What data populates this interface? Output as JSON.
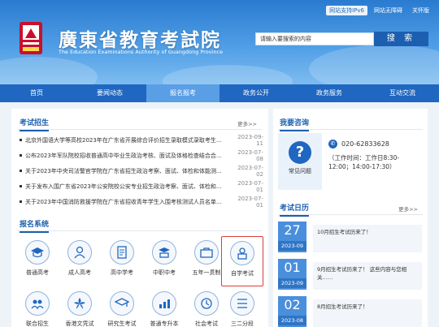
{
  "header": {
    "top_links": [
      "网站支持IPv6",
      "网站无障碍",
      "关怀版"
    ],
    "title": "廣東省教育考試院",
    "subtitle": "The Education Examinations Authority of Guangdong Province",
    "search_placeholder": "请输入要搜索的内容",
    "search_button": "搜 索"
  },
  "nav": [
    "首页",
    "要闻动态",
    "报名报考",
    "政务公开",
    "政务服务",
    "互动交流"
  ],
  "nav_active": "报名报考",
  "exam_enroll": {
    "title": "考试招生",
    "more": "更多>>",
    "items": [
      {
        "title": "北京外国语大学等高校2023年在广东省开展综合评价招生录取模式录取考生...",
        "date": "2023-09-11"
      },
      {
        "title": "公布2023年军队院校招收普通高中毕业生政治考核、面试及体格检查结合合格...",
        "date": "2023-07-08"
      },
      {
        "title": "关于2023年中央司法警官学院在广东省招生政治考察、面试、体检和体能测...",
        "date": "2023-07-02"
      },
      {
        "title": "关于发布入围广东省2023年公安院校公安专业招生政治考察、面试、体检和...",
        "date": "2023-07-01"
      },
      {
        "title": "关于2023年中国消防救援学院在广东省招收青年学生入围考核测试人员名单...",
        "date": "2023-07-01"
      }
    ]
  },
  "sys": {
    "title": "报名系统",
    "items": [
      {
        "label": "普通高考",
        "icon": "graduation-cap-icon"
      },
      {
        "label": "成人高考",
        "icon": "adult-user-icon"
      },
      {
        "label": "高中学考",
        "icon": "document-icon"
      },
      {
        "label": "中职中考",
        "icon": "cap-book-icon"
      },
      {
        "label": "五年一贯制",
        "icon": "briefcase-icon"
      },
      {
        "label": "自学考试",
        "icon": "self-study-icon"
      },
      {
        "label": "联合招生",
        "icon": "group-icon"
      },
      {
        "label": "香港文凭试",
        "icon": "bauhinia-icon"
      },
      {
        "label": "研究生考试",
        "icon": "cap-icon"
      },
      {
        "label": "普通专升本",
        "icon": "chart-icon"
      },
      {
        "label": "社会考试",
        "icon": "society-icon"
      },
      {
        "label": "三二分段",
        "icon": "split-icon"
      }
    ]
  },
  "consult": {
    "title": "我要咨询",
    "faq_label": "常见问题",
    "phone": "020-62833628",
    "hours_line1": "（工作时间：工作日8:30-",
    "hours_line2": "12:00；14:00-17:30）"
  },
  "calendar": {
    "title": "考试日历",
    "more": "更多>>",
    "items": [
      {
        "day": "27",
        "month": "2023-09",
        "text": "10月招生考试历来了！"
      },
      {
        "day": "01",
        "month": "2023-09",
        "text": "9月招生考试历来了！ 这些内容与您相关……"
      },
      {
        "day": "02",
        "month": "2023-08",
        "text": "8月招生考试历来了！"
      }
    ]
  },
  "colors": {
    "primary": "#1f67c0",
    "highlight": "#e03b3b"
  }
}
